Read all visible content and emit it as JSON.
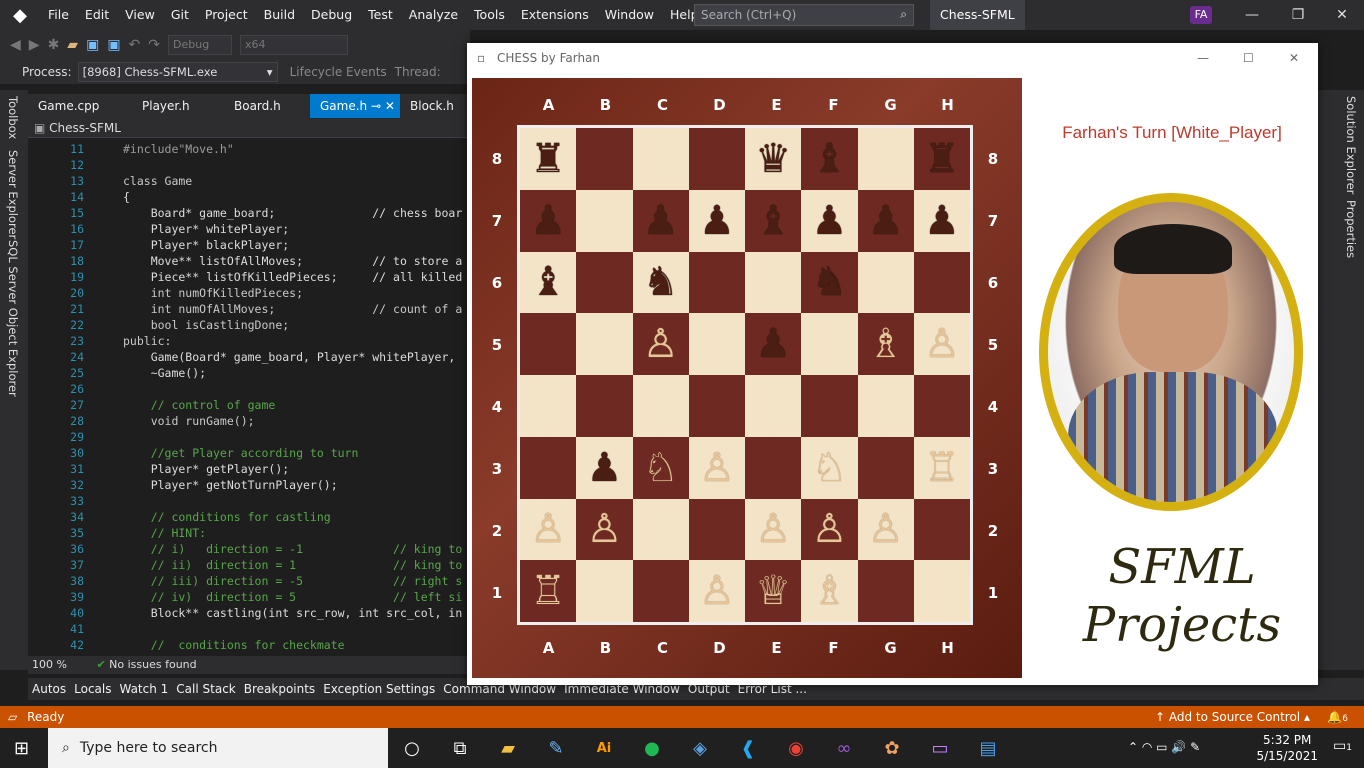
{
  "menubar": {
    "items": [
      "File",
      "Edit",
      "View",
      "Git",
      "Project",
      "Build",
      "Debug",
      "Test",
      "Analyze",
      "Tools",
      "Extensions",
      "Window",
      "Help"
    ],
    "search_placeholder": "Search (Ctrl+Q)",
    "solution_title": "Chess-SFML",
    "avatar": "FA"
  },
  "toolbar": {
    "config": "Debug",
    "platform": "x64"
  },
  "process": {
    "label": "Process:",
    "value": "[8968] Chess-SFML.exe",
    "lifecycle": "Lifecycle Events",
    "thread": "Thread:"
  },
  "left_rail": {
    "toolbox": "Toolbox",
    "server_explorer": "Server Explorer",
    "sql": "SQL Server Object Explorer"
  },
  "right_rail": {
    "solution_explorer": "Solution Explorer",
    "properties": "Properties"
  },
  "tabs": [
    {
      "label": "Game.cpp"
    },
    {
      "label": "Player.h"
    },
    {
      "label": "Board.h"
    },
    {
      "label": "Game.h"
    },
    {
      "label": "Block.h"
    }
  ],
  "navbar": {
    "project": "Chess-SFML"
  },
  "code": [
    {
      "n": "11",
      "t": "#include\"Move.h\""
    },
    {
      "n": "12",
      "t": ""
    },
    {
      "n": "13",
      "t": "class Game"
    },
    {
      "n": "14",
      "t": "{"
    },
    {
      "n": "15",
      "t": "    Board* game_board;              // chess boar"
    },
    {
      "n": "16",
      "t": "    Player* whitePlayer;"
    },
    {
      "n": "17",
      "t": "    Player* blackPlayer;"
    },
    {
      "n": "18",
      "t": "    Move** listOfAllMoves;          // to store a"
    },
    {
      "n": "19",
      "t": "    Piece** listOfKilledPieces;     // all killed"
    },
    {
      "n": "20",
      "t": "    int numOfKilledPieces;"
    },
    {
      "n": "21",
      "t": "    int numOfAllMoves;              // count of a"
    },
    {
      "n": "22",
      "t": "    bool isCastlingDone;"
    },
    {
      "n": "23",
      "t": "public:"
    },
    {
      "n": "24",
      "t": "    Game(Board* game_board, Player* whitePlayer,"
    },
    {
      "n": "25",
      "t": "    ~Game();"
    },
    {
      "n": "26",
      "t": ""
    },
    {
      "n": "27",
      "t": "    // control of game"
    },
    {
      "n": "28",
      "t": "    void runGame();"
    },
    {
      "n": "29",
      "t": ""
    },
    {
      "n": "30",
      "t": "    //get Player according to turn"
    },
    {
      "n": "31",
      "t": "    Player* getPlayer();"
    },
    {
      "n": "32",
      "t": "    Player* getNotTurnPlayer();"
    },
    {
      "n": "33",
      "t": ""
    },
    {
      "n": "34",
      "t": "    // conditions for castling"
    },
    {
      "n": "35",
      "t": "    // HINT:"
    },
    {
      "n": "36",
      "t": "    // i)   direction = -1             // king to"
    },
    {
      "n": "37",
      "t": "    // ii)  direction = 1              // king to"
    },
    {
      "n": "38",
      "t": "    // iii) direction = -5             // right s"
    },
    {
      "n": "39",
      "t": "    // iv)  direction = 5              // left si"
    },
    {
      "n": "40",
      "t": "    Block** castling(int src_row, int src_col, in"
    },
    {
      "n": "41",
      "t": ""
    },
    {
      "n": "42",
      "t": "    //  conditions for checkmate"
    }
  ],
  "editor_status": {
    "zoom": "100 %",
    "issues": "No issues found"
  },
  "bottom_tabs": [
    "Autos",
    "Locals",
    "Watch 1",
    "Call Stack",
    "Breakpoints",
    "Exception Settings",
    "Command Window",
    "Immediate Window",
    "Output",
    "Error List ..."
  ],
  "vs_status": {
    "ready": "Ready",
    "source_control": "Add to Source Control",
    "notif_count": "6"
  },
  "chess": {
    "window_title": "CHESS by Farhan",
    "turn": "Farhan's Turn [White_Player]",
    "files": [
      "A",
      "B",
      "C",
      "D",
      "E",
      "F",
      "G",
      "H"
    ],
    "ranks": [
      "8",
      "7",
      "6",
      "5",
      "4",
      "3",
      "2",
      "1"
    ],
    "board": [
      [
        "♜",
        "",
        "",
        "",
        "♛",
        "♝",
        "",
        "♜"
      ],
      [
        "♟",
        "",
        "♟",
        "♟",
        "♝",
        "♟",
        "♟",
        "♟"
      ],
      [
        "♝",
        "",
        "♞",
        "",
        "",
        "♞",
        "",
        ""
      ],
      [
        "",
        "",
        "♙",
        "",
        "♟",
        "",
        "♗",
        "♙"
      ],
      [
        "",
        "",
        "",
        "",
        "",
        "",
        "",
        ""
      ],
      [
        "",
        "♟",
        "♘",
        "♙",
        "",
        "♘",
        "",
        "♖"
      ],
      [
        "♙",
        "♙",
        "",
        "",
        "♙",
        "♙",
        "♙",
        ""
      ],
      [
        "♖",
        "",
        "",
        "♙",
        "♕",
        "♗",
        "",
        ""
      ]
    ],
    "brand_line1": "SFML",
    "brand_line2": "Projects"
  },
  "taskbar": {
    "search_placeholder": "Type here to search",
    "time": "5:32 PM",
    "date": "5/15/2021",
    "notif": "1"
  }
}
